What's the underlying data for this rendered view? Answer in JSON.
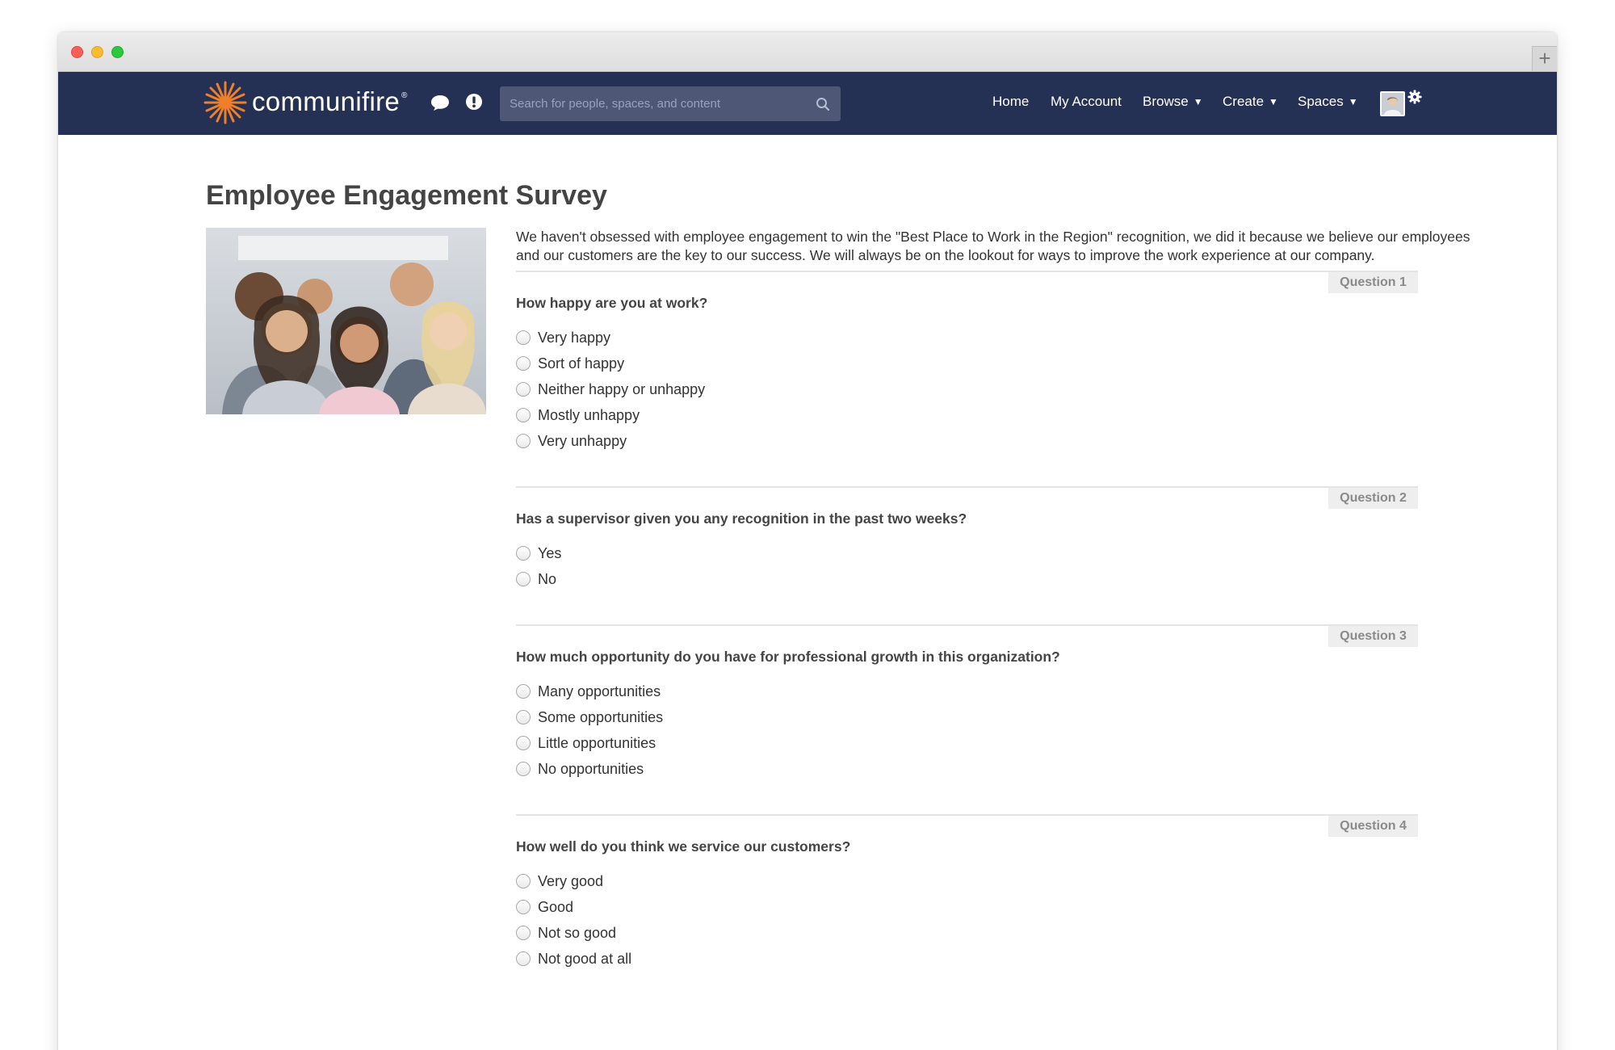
{
  "navbar": {
    "brand": "communifire",
    "brand_mark": "®",
    "search_placeholder": "Search for people, spaces, and content",
    "menu": {
      "home": "Home",
      "my_account": "My Account",
      "browse": "Browse",
      "create": "Create",
      "spaces": "Spaces"
    },
    "caret": "▼",
    "colors": {
      "bar": "#253055",
      "logo_accent": "#f07f2a"
    }
  },
  "page": {
    "title": "Employee Engagement Survey",
    "intro": "We haven't obsessed with employee engagement to win the \"Best Place to Work in the Region\" recognition, we did it because we believe our employees and our customers are the key to our success. We will always be on the lookout for ways to improve the work experience at our company."
  },
  "questions": [
    {
      "badge": "Question 1",
      "text": "How happy are you at work?",
      "options": [
        "Very happy",
        "Sort of happy",
        "Neither happy or unhappy",
        "Mostly unhappy",
        "Very unhappy"
      ]
    },
    {
      "badge": "Question 2",
      "text": "Has a supervisor given you any recognition in the past two weeks?",
      "options": [
        "Yes",
        "No"
      ]
    },
    {
      "badge": "Question 3",
      "text": "How much opportunity do you have for professional growth in this organization?",
      "options": [
        "Many opportunities",
        "Some opportunities",
        "Little opportunities",
        "No opportunities"
      ]
    },
    {
      "badge": "Question 4",
      "text": "How well do you think we service our customers?",
      "options": [
        "Very good",
        "Good",
        "Not so good",
        "Not good at all"
      ]
    }
  ],
  "icons": {
    "chat": "chat-bubble-icon",
    "alert": "exclamation-circle-icon",
    "search": "search-icon",
    "settings": "gear-icon",
    "new_tab": "+"
  }
}
